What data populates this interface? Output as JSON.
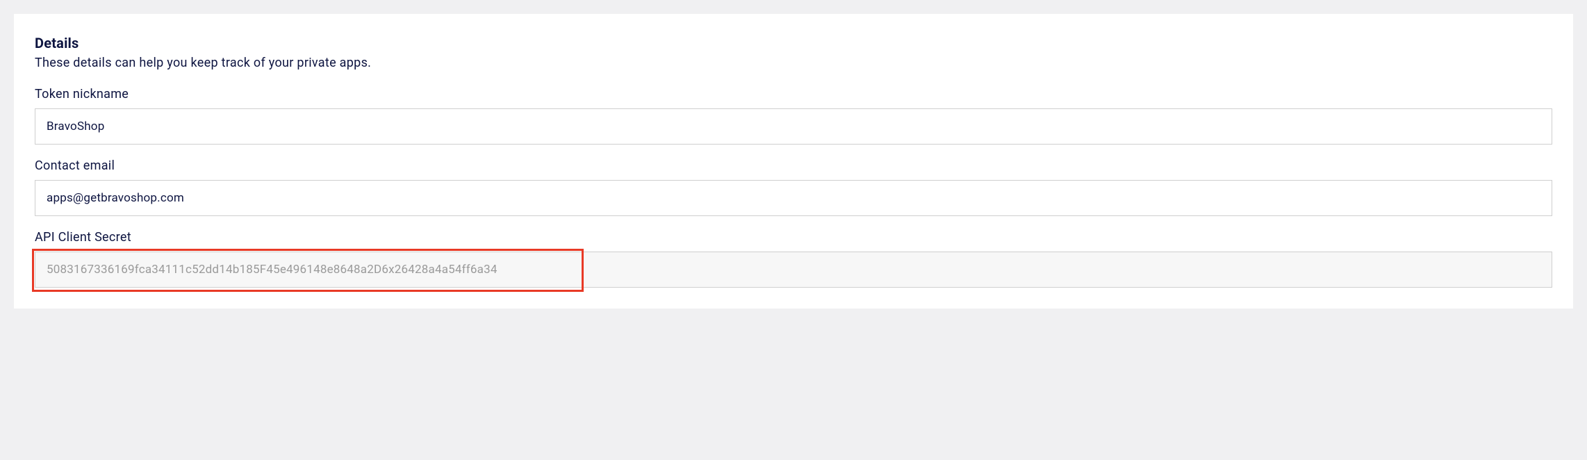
{
  "section": {
    "title": "Details",
    "description": "These details can help you keep track of your private apps."
  },
  "fields": {
    "nickname": {
      "label": "Token nickname",
      "value": "BravoShop"
    },
    "email": {
      "label": "Contact email",
      "value": "apps@getbravoshop.com"
    },
    "secret": {
      "label": "API Client Secret",
      "value": "5083167336169fca34111c52dd14b185F45e496148e8648a2D6x26428a4a54ff6a34"
    }
  }
}
